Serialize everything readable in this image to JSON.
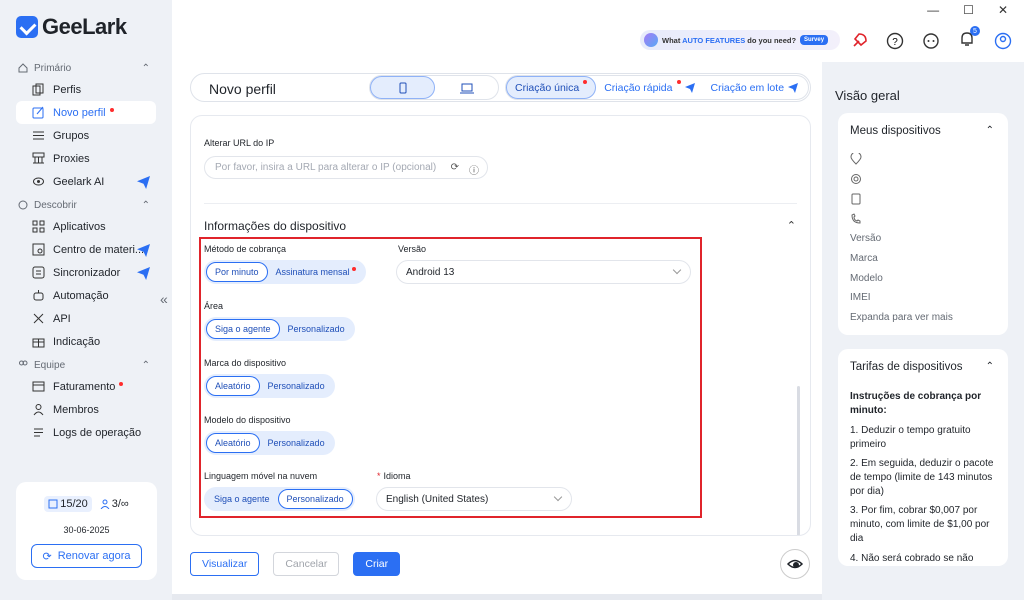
{
  "window": {
    "minimize": "—",
    "maximize": "☐",
    "close": "✕"
  },
  "brand": {
    "name": "GeeLark"
  },
  "sidebar": {
    "sections": [
      {
        "label": "Primário",
        "items": [
          {
            "label": "Perfis"
          },
          {
            "label": "Novo perfil"
          },
          {
            "label": "Grupos"
          },
          {
            "label": "Proxies"
          },
          {
            "label": "Geelark AI"
          }
        ]
      },
      {
        "label": "Descobrir",
        "items": [
          {
            "label": "Aplicativos"
          },
          {
            "label": "Centro de materi..."
          },
          {
            "label": "Sincronizador"
          },
          {
            "label": "Automação"
          },
          {
            "label": "API"
          },
          {
            "label": "Indicação"
          }
        ]
      },
      {
        "label": "Equipe",
        "items": [
          {
            "label": "Faturamento"
          },
          {
            "label": "Membros"
          },
          {
            "label": "Logs de operação"
          }
        ]
      }
    ],
    "collapse_label": "«",
    "plan": {
      "devices": "15/20",
      "members": "3/∞",
      "date": "30-06-2025",
      "renew_label": "Renovar agora"
    }
  },
  "topbar": {
    "survey_text_pre": "What ",
    "survey_text_bold": "AUTO FEATURES",
    "survey_text_post": " do you need?",
    "survey_button": "Survey",
    "notification_count": "5"
  },
  "main": {
    "title": "Novo perfil",
    "modes": [
      {
        "label": "Criação única"
      },
      {
        "label": "Criação rápida"
      },
      {
        "label": "Criação em lote"
      }
    ],
    "url_label": "Alterar URL do IP",
    "url_placeholder": "Por favor, insira a URL para alterar o IP (opcional)",
    "device_section_title": "Informações do dispositivo",
    "billing": {
      "label": "Método de cobrança",
      "options": [
        "Por minuto",
        "Assinatura mensal"
      ]
    },
    "version": {
      "label": "Versão",
      "value": "Android 13"
    },
    "area": {
      "label": "Área",
      "options": [
        "Siga o agente",
        "Personalizado"
      ]
    },
    "brand": {
      "label": "Marca do dispositivo",
      "options": [
        "Aleatório",
        "Personalizado"
      ]
    },
    "model": {
      "label": "Modelo do dispositivo",
      "options": [
        "Aleatório",
        "Personalizado"
      ]
    },
    "cloud_lang": {
      "label": "Linguagem móvel na nuvem",
      "options": [
        "Siga o agente",
        "Personalizado"
      ]
    },
    "language": {
      "required_mark": "*",
      "label": "Idioma",
      "value": "English (United States)"
    },
    "buttons": {
      "preview": "Visualizar",
      "cancel": "Cancelar",
      "create": "Criar"
    }
  },
  "right": {
    "title": "Visão geral",
    "devices_card": {
      "title": "Meus dispositivos",
      "fields": [
        "Versão",
        "Marca",
        "Modelo",
        "IMEI",
        "Expanda para ver mais"
      ]
    },
    "rates_card": {
      "title": "Tarifas de dispositivos",
      "heading": "Instruções de cobrança por minuto:",
      "items": [
        "1. Deduzir o tempo gratuito primeiro",
        "2. Em seguida, deduzir o pacote de tempo (limite de 143 minutos por dia)",
        "3. Por fim, cobrar $0,007 por minuto, com limite de $1,00 por dia",
        "4. Não será cobrado se não"
      ]
    }
  },
  "colors": {
    "accent": "#2b6ff3",
    "highlight": "#e0242b",
    "dot": "#ff2d2d"
  }
}
